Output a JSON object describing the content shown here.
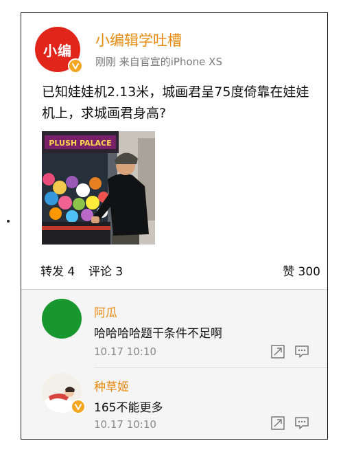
{
  "post": {
    "author": "小编辑学吐槽",
    "avatar_text": "小编",
    "meta": "刚刚 来自官宣的iPhone XS",
    "text": "已知娃娃机2.13米，城画君呈75度倚靠在娃娃机上，求城画君身高?",
    "image_sign": "PLUSH PALACE"
  },
  "actions": {
    "repost": "转发 4",
    "comment": "评论 3",
    "like": "赞 300"
  },
  "comments": [
    {
      "name": "阿瓜",
      "text": "哈哈哈哈题干条件不足啊",
      "time": "10.17 10:10",
      "avatar_color": "#17972e"
    },
    {
      "name": "种草姬",
      "text": "165不能更多",
      "time": "10.17 10:10"
    }
  ],
  "colors": {
    "accent_orange": "#e8890c",
    "avatar_red": "#e1251b",
    "verified_badge": "#f5a623"
  }
}
